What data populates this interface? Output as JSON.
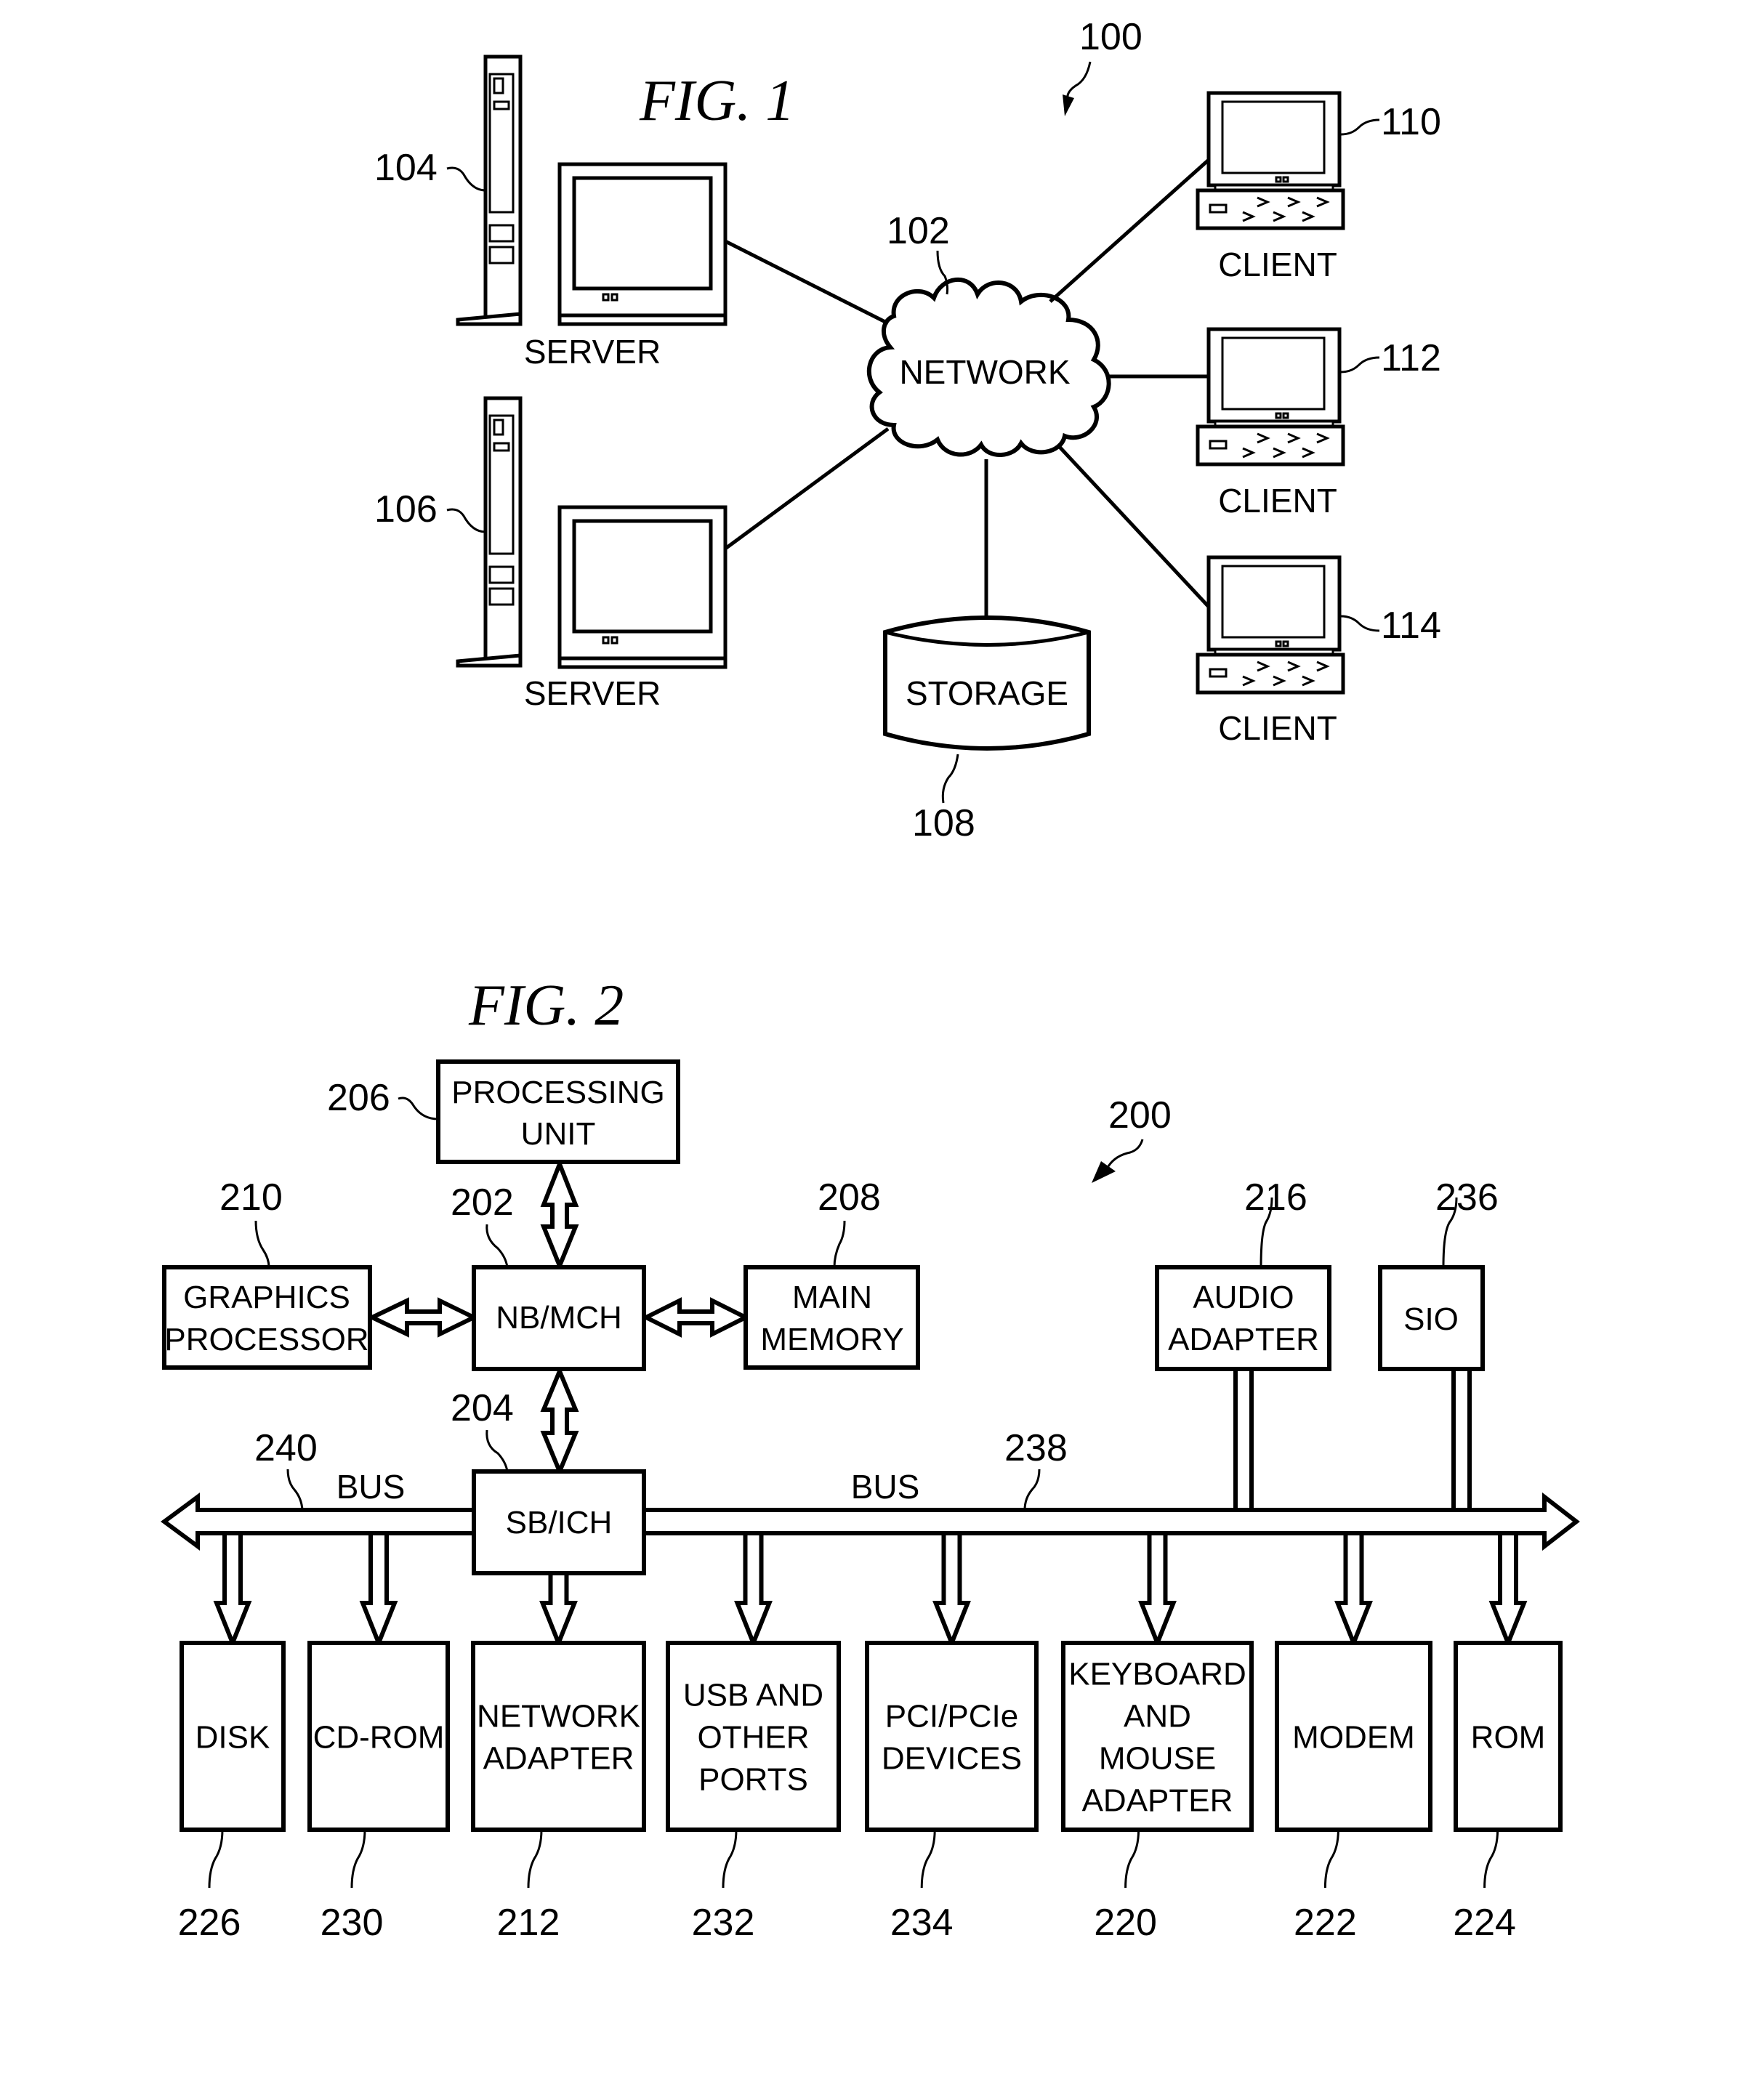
{
  "fig1": {
    "title": "FIG. 1",
    "system_ref": "100",
    "network": {
      "label": "NETWORK",
      "ref": "102"
    },
    "servers": [
      {
        "label": "SERVER",
        "ref": "104"
      },
      {
        "label": "SERVER",
        "ref": "106"
      }
    ],
    "storage": {
      "label": "STORAGE",
      "ref": "108"
    },
    "clients": [
      {
        "label": "CLIENT",
        "ref": "110"
      },
      {
        "label": "CLIENT",
        "ref": "112"
      },
      {
        "label": "CLIENT",
        "ref": "114"
      }
    ]
  },
  "fig2": {
    "title": "FIG. 2",
    "system_ref": "200",
    "processing_unit": {
      "lines": [
        "PROCESSING",
        "UNIT"
      ],
      "ref": "206"
    },
    "nb_mch": {
      "lines": [
        "NB/MCH"
      ],
      "ref": "202"
    },
    "graphics": {
      "lines": [
        "GRAPHICS",
        "PROCESSOR"
      ],
      "ref": "210"
    },
    "main_memory": {
      "lines": [
        "MAIN",
        "MEMORY"
      ],
      "ref": "208"
    },
    "audio": {
      "lines": [
        "AUDIO",
        "ADAPTER"
      ],
      "ref": "216"
    },
    "sio": {
      "lines": [
        "SIO"
      ],
      "ref": "236"
    },
    "sb_ich": {
      "lines": [
        "SB/ICH"
      ],
      "ref": "204"
    },
    "bus_left": {
      "label": "BUS",
      "ref": "240"
    },
    "bus_right": {
      "label": "BUS",
      "ref": "238"
    },
    "devices": [
      {
        "id": "disk",
        "lines": [
          "DISK"
        ],
        "ref": "226"
      },
      {
        "id": "cd-rom",
        "lines": [
          "CD-ROM"
        ],
        "ref": "230"
      },
      {
        "id": "network-adapter",
        "lines": [
          "NETWORK",
          "ADAPTER"
        ],
        "ref": "212"
      },
      {
        "id": "usb-ports",
        "lines": [
          "USB AND",
          "OTHER",
          "PORTS"
        ],
        "ref": "232"
      },
      {
        "id": "pci-devices",
        "lines": [
          "PCI/PCIe",
          "DEVICES"
        ],
        "ref": "234"
      },
      {
        "id": "keyboard-mouse-adapter",
        "lines": [
          "KEYBOARD",
          "AND",
          "MOUSE",
          "ADAPTER"
        ],
        "ref": "220"
      },
      {
        "id": "modem",
        "lines": [
          "MODEM"
        ],
        "ref": "222"
      },
      {
        "id": "rom",
        "lines": [
          "ROM"
        ],
        "ref": "224"
      }
    ]
  }
}
